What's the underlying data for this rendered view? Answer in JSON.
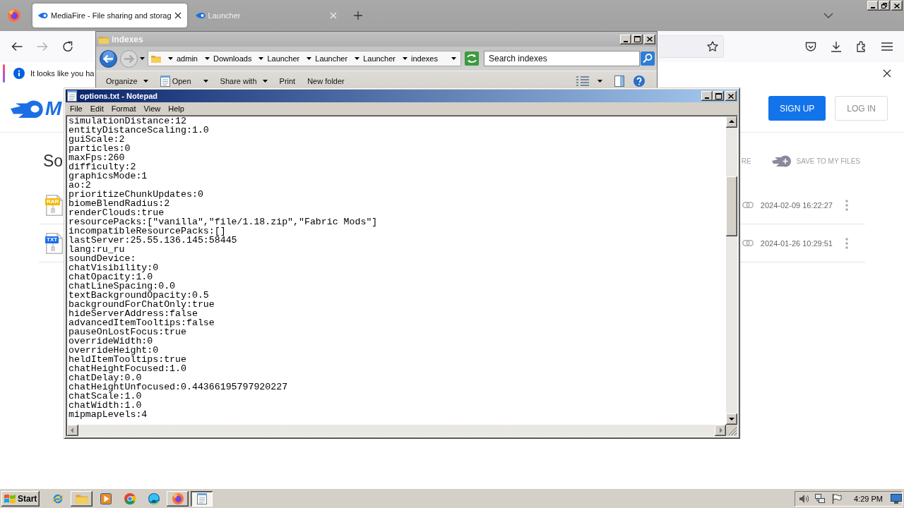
{
  "browser": {
    "tabs": [
      {
        "title": "MediaFire - File sharing and storag",
        "selected": true
      },
      {
        "title": "Launcher",
        "selected": false
      }
    ],
    "notification": "It looks like you ha"
  },
  "mediafire": {
    "logo_text": "M",
    "buttons": [
      {
        "label": "SIGN UP",
        "kind": "primary"
      },
      {
        "label": "LOG IN",
        "kind": "secondary"
      }
    ],
    "heading": "So",
    "actions": [
      {
        "label": "RE",
        "kind": "share"
      },
      {
        "label": "SAVE TO MY FILES",
        "kind": "save"
      }
    ],
    "files": [
      {
        "badge": "RAR",
        "color": "#f5b800",
        "date": "2024-02-09 16:22:27"
      },
      {
        "badge": "TXT",
        "color": "#1a6fe4",
        "date": "2024-01-26 10:29:51"
      }
    ]
  },
  "explorer": {
    "title": "indexes",
    "path": [
      "admin",
      "Downloads",
      "Launcher",
      "Launcher",
      "Launcher",
      "indexes"
    ],
    "search": {
      "placeholder": "Search indexes"
    },
    "toolbar": [
      {
        "label": "Organize",
        "kind": "menu"
      },
      {
        "label": "Open",
        "kind": "open"
      },
      {
        "label": "Share with",
        "kind": "menu"
      },
      {
        "label": "Print",
        "kind": "plain"
      },
      {
        "label": "New folder",
        "kind": "plain"
      }
    ]
  },
  "notepad": {
    "title": "options.txt - Notepad",
    "menu": [
      "File",
      "Edit",
      "Format",
      "View",
      "Help"
    ],
    "lines": [
      "simulationDistance:12",
      "entityDistanceScaling:1.0",
      "guiScale:2",
      "particles:0",
      "maxFps:260",
      "difficulty:2",
      "graphicsMode:1",
      "ao:2",
      "prioritizeChunkUpdates:0",
      "biomeBlendRadius:2",
      "renderClouds:true",
      "resourcePacks:[\"vanilla\",\"file/1.18.zip\",\"Fabric Mods\"]",
      "incompatibleResourcePacks:[]",
      "lastServer:25.55.136.145:58445",
      "lang:ru_ru",
      "soundDevice:",
      "chatVisibility:0",
      "chatOpacity:1.0",
      "chatLineSpacing:0.0",
      "textBackgroundOpacity:0.5",
      "backgroundForChatOnly:true",
      "hideServerAddress:false",
      "advancedItemTooltips:false",
      "pauseOnLostFocus:true",
      "overrideWidth:0",
      "overrideHeight:0",
      "heldItemTooltips:true",
      "chatHeightFocused:1.0",
      "chatDelay:0.0",
      "chatHeightUnfocused:0.44366195797920227",
      "chatScale:1.0",
      "chatWidth:1.0",
      "mipmapLevels:4"
    ]
  },
  "taskbar": {
    "start": "Start",
    "buttons": [
      {
        "kind": "ie",
        "running": false,
        "selected": false
      },
      {
        "kind": "explorer",
        "running": true,
        "selected": false
      },
      {
        "kind": "media",
        "running": false,
        "selected": false
      },
      {
        "kind": "chrome",
        "running": false,
        "selected": false
      },
      {
        "kind": "edge",
        "running": false,
        "selected": false
      },
      {
        "kind": "firefox",
        "running": true,
        "selected": false
      },
      {
        "kind": "notepad",
        "running": true,
        "selected": true
      }
    ],
    "clock": "4:29 PM"
  }
}
